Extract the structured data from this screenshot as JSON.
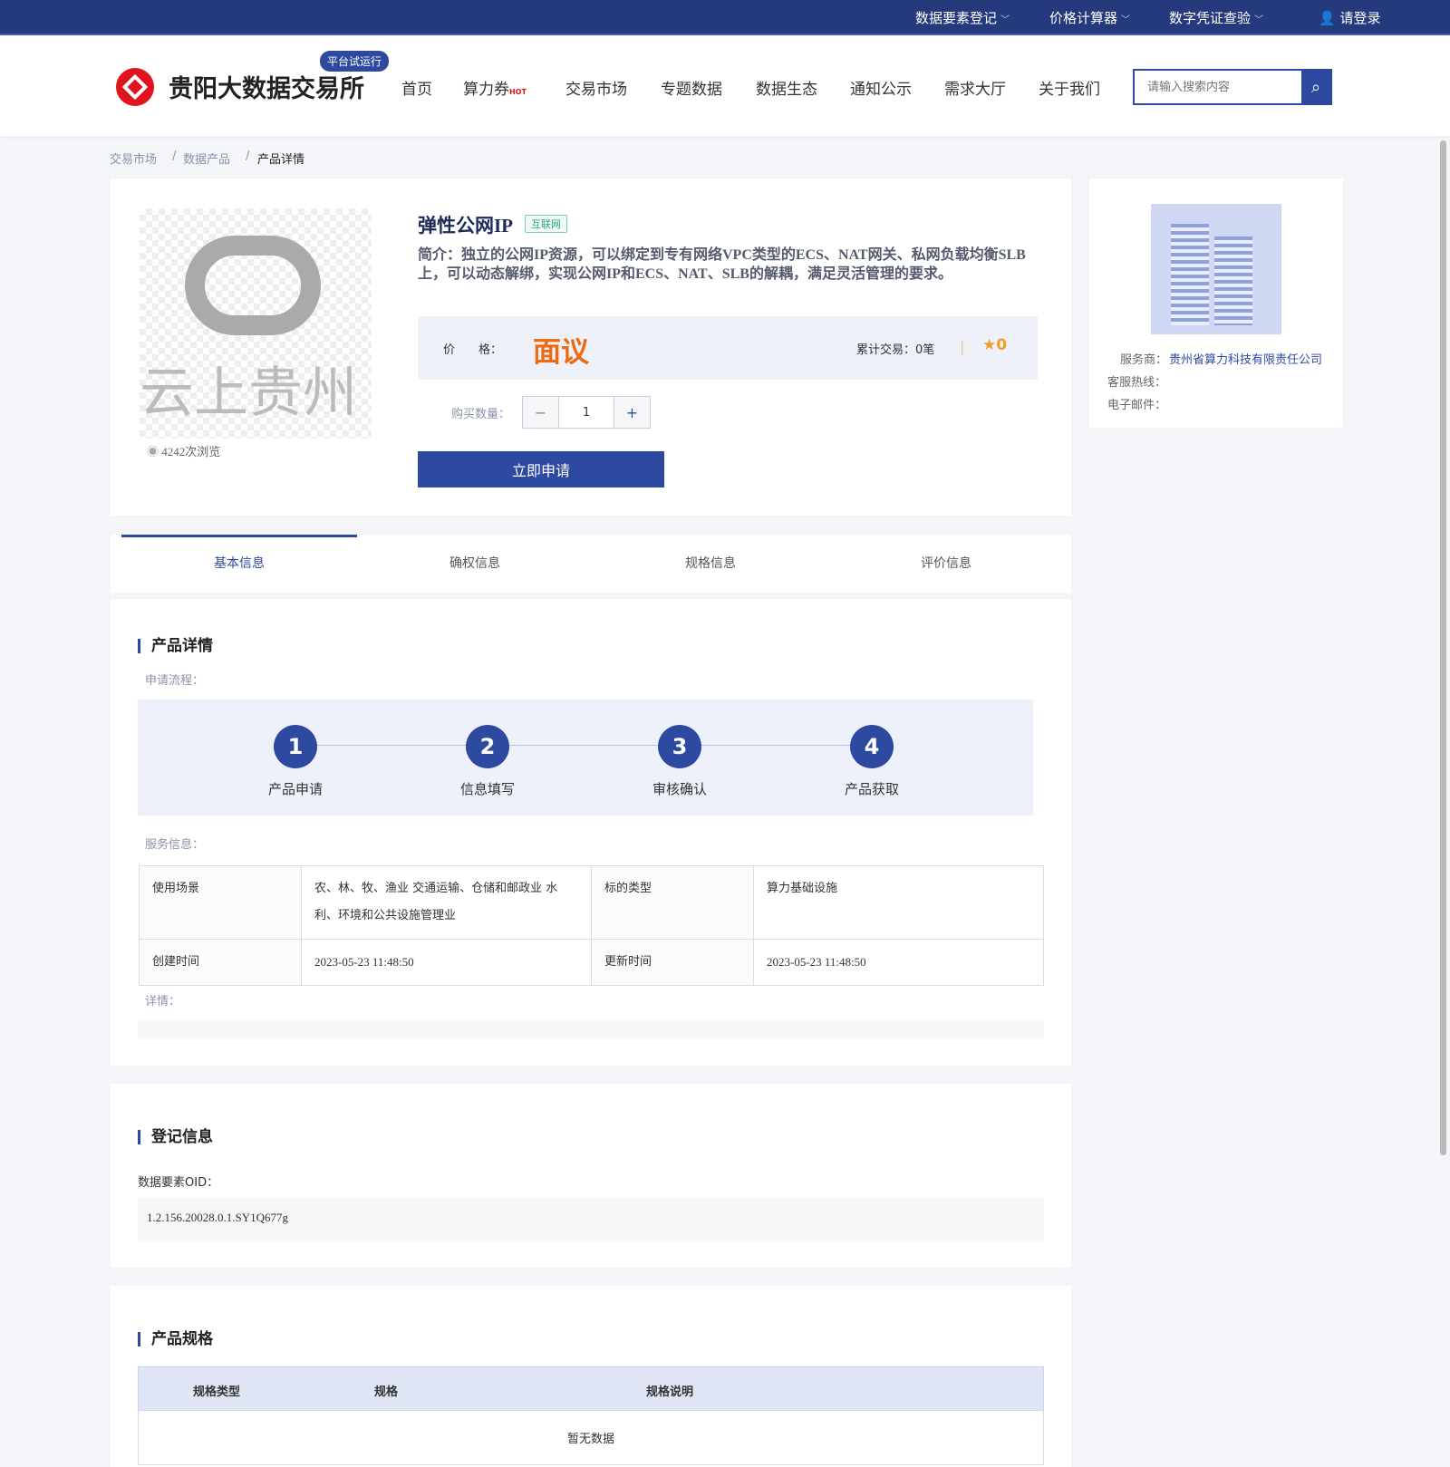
{
  "topbar": {
    "items": [
      "数据要素登记",
      "价格计算器",
      "数字凭证查验"
    ],
    "login": "请登录"
  },
  "header": {
    "brand": "贵阳大数据交易所",
    "badge": "平台试运行",
    "nav": [
      "首页",
      "算力券",
      "交易市场",
      "专题数据",
      "数据生态",
      "通知公示",
      "需求大厅",
      "关于我们"
    ],
    "hot": "HOT",
    "search_placeholder": "请输入搜索内容"
  },
  "breadcrumb": [
    "交易市场",
    "数据产品",
    "产品详情"
  ],
  "product": {
    "title": "弹性公网IP",
    "tag": "互联网",
    "desc": "简介：独立的公网IP资源，可以绑定到专有网络VPC类型的ECS、NAT网关、私网负载均衡SLB上，可以动态解绑，实现公网IP和ECS、NAT、SLB的解耦，满足灵活管理的要求。",
    "price_label": "价　　格：",
    "price": "面议",
    "trade_label": "累计交易：",
    "trade_count": "0笔",
    "rating": "0",
    "qty_label": "购买数量：",
    "qty": "1",
    "apply": "立即申请",
    "views": "4242次浏览",
    "watermark": "云上贵州"
  },
  "provider": {
    "label": "服务商：",
    "name": "贵州省算力科技有限责任公司",
    "hotline_label": "客服热线：",
    "email_label": "电子邮件："
  },
  "tabs": [
    "基本信息",
    "确权信息",
    "规格信息",
    "评价信息"
  ],
  "detail": {
    "title": "产品详情",
    "flow_label": "申请流程：",
    "steps": [
      {
        "n": "1",
        "t": "产品申请"
      },
      {
        "n": "2",
        "t": "信息填写"
      },
      {
        "n": "3",
        "t": "审核确认"
      },
      {
        "n": "4",
        "t": "产品获取"
      }
    ],
    "service_label": "服务信息：",
    "table": {
      "scene_k": "使用场景",
      "scene_v": "农、林、牧、渔业 交通运输、仓储和邮政业 水利、环境和公共设施管理业",
      "type_k": "标的类型",
      "type_v": "算力基础设施",
      "created_k": "创建时间",
      "created_v": "2023-05-23 11:48:50",
      "updated_k": "更新时间",
      "updated_v": "2023-05-23 11:48:50"
    },
    "more_label": "详情："
  },
  "register": {
    "title": "登记信息",
    "oid_label": "数据要素OID：",
    "oid": "1.2.156.20028.0.1.SY1Q677g"
  },
  "spec": {
    "title": "产品规格",
    "cols": [
      "规格类型",
      "规格",
      "规格说明"
    ],
    "empty": "暂无数据"
  }
}
